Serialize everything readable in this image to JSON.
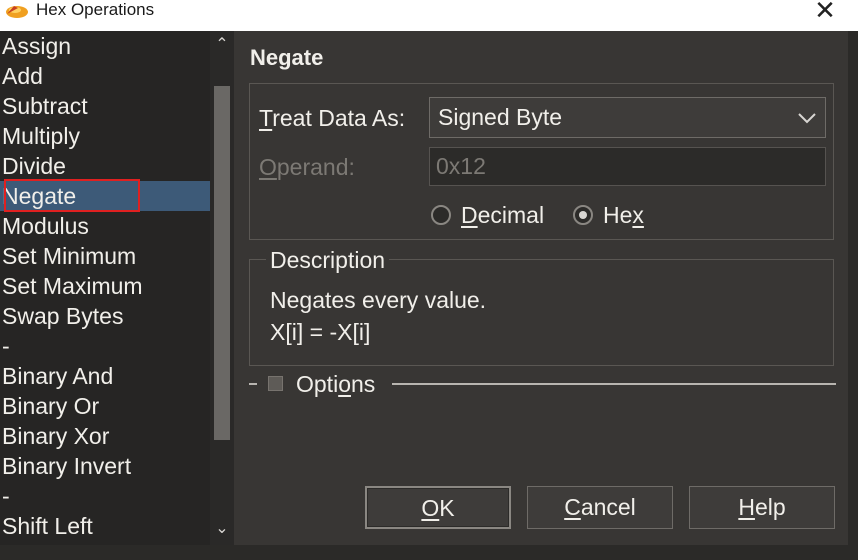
{
  "window": {
    "title": "Hex Operations",
    "close_glyph": "✕"
  },
  "operations": {
    "items": [
      {
        "label": "Assign"
      },
      {
        "label": "Add"
      },
      {
        "label": "Subtract"
      },
      {
        "label": "Multiply"
      },
      {
        "label": "Divide"
      },
      {
        "label": "Negate",
        "selected": true
      },
      {
        "label": "Modulus"
      },
      {
        "label": "Set Minimum"
      },
      {
        "label": "Set Maximum"
      },
      {
        "label": "Swap Bytes"
      },
      {
        "label": "-"
      },
      {
        "label": "Binary And"
      },
      {
        "label": "Binary Or"
      },
      {
        "label": "Binary Xor"
      },
      {
        "label": "Binary Invert"
      },
      {
        "label": "-"
      },
      {
        "label": "Shift Left"
      }
    ]
  },
  "panel": {
    "heading": "Negate",
    "treat_data_as": {
      "label_underlined": "T",
      "label_rest": "reat Data As:",
      "value": "Signed Byte"
    },
    "operand": {
      "label_underlined": "O",
      "label_rest": "perand:",
      "value": "0x12"
    },
    "radio_decimal": {
      "label_underlined": "D",
      "label_rest": "ecimal",
      "checked": false
    },
    "radio_hex": {
      "label_pre": "He",
      "label_underlined": "x",
      "checked": true
    },
    "description": {
      "legend": "Description",
      "line1": "Negates every value.",
      "line2": "X[i] = -X[i]"
    },
    "options": {
      "label_pre": "Opti",
      "label_underlined": "o",
      "label_post": "ns"
    }
  },
  "buttons": {
    "ok": {
      "underlined": "O",
      "rest": "K"
    },
    "cancel": {
      "underlined": "C",
      "rest": "ancel"
    },
    "help": {
      "underlined": "H",
      "rest": "elp"
    }
  },
  "colors": {
    "selection": "#3d5a78",
    "highlight_box": "#e02020",
    "dialog_background": "#383634"
  }
}
